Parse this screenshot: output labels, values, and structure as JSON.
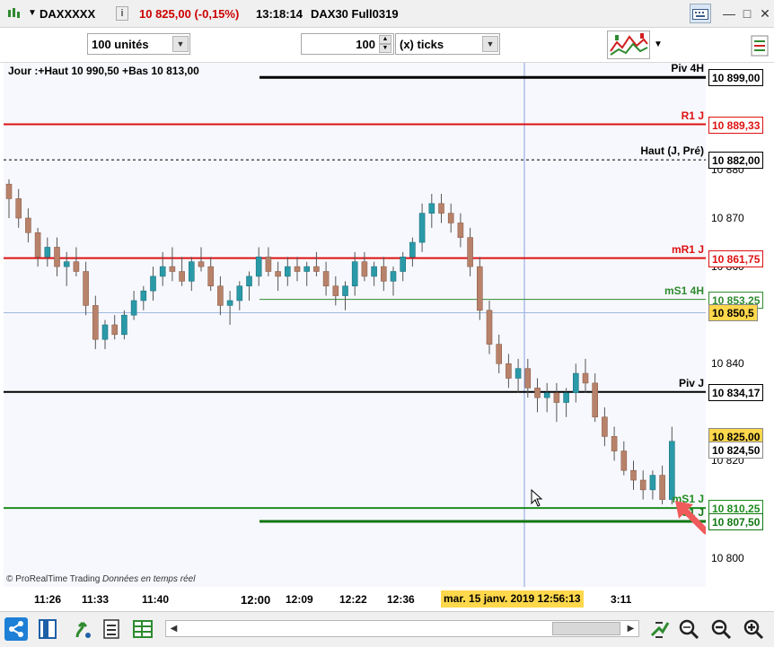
{
  "titlebar": {
    "instrument": "DAXXXXX",
    "price": "10 825,00 (-0,15%)",
    "time": "13:18:14",
    "name": "DAX30 Full0319",
    "colors": {
      "price": "#cc0000"
    }
  },
  "toolbar": {
    "units": "100 unités",
    "ticks_value": "100",
    "ticks_label": "(x) ticks"
  },
  "chart": {
    "day_info": "Jour :+Haut 10 990,50 +Bas 10 813,00",
    "source": "© ProRealTime Trading",
    "source_note": "Données en temps réel"
  },
  "levels": [
    {
      "name": "Piv 4H",
      "value": "10 899,00",
      "price": 10899.0,
      "color": "#000000",
      "style": "solid-thick",
      "label_color": "#000000",
      "box_color": "#000000"
    },
    {
      "name": "R1 J",
      "value": "10 889,33",
      "price": 10889.33,
      "color": "#dd1111",
      "style": "solid",
      "label_color": "#dd1111",
      "box_color": "#dd1111"
    },
    {
      "name": "Haut (J, Pré)",
      "value": "10 882,00",
      "price": 10882.0,
      "color": "#000000",
      "style": "dashed",
      "label_color": "#000000",
      "box_color": "#000000"
    },
    {
      "name": "mR1 J",
      "value": "10 861,75",
      "price": 10861.75,
      "color": "#dd1111",
      "style": "solid",
      "label_color": "#dd1111",
      "box_color": "#dd1111"
    },
    {
      "name": "mS1 4H",
      "value": "10 853,25",
      "price": 10853.25,
      "color": "#2f8a2f",
      "style": "thin",
      "label_color": "#2f8a2f",
      "box_color": "#2f8a2f"
    },
    {
      "name": "Piv J",
      "value": "10 834,17",
      "price": 10834.17,
      "color": "#000000",
      "style": "solid",
      "label_color": "#000000",
      "box_color": "#000000"
    },
    {
      "name": "mS1 J",
      "value": "10 810,25",
      "price": 10810.25,
      "color": "#1e8c1e",
      "style": "solid",
      "label_color": "#1e8c1e",
      "box_color": "#1e8c1e"
    },
    {
      "name": "S1 J",
      "value": "10 807,50",
      "price": 10807.5,
      "color": "#117711",
      "style": "solid-thick",
      "label_color": "#117711",
      "box_color": "#117711"
    }
  ],
  "crosshair": {
    "value": "10 850,5",
    "price": 10850.5
  },
  "last_price": {
    "value": "10 825,00",
    "price": 10825.0
  },
  "current_price": {
    "value": "10 824,50",
    "price": 10824.5
  },
  "scale_ticks": [
    "10 880",
    "10 870",
    "10 860",
    "10 840",
    "10 820",
    "10 800"
  ],
  "time_labels": [
    "11:26",
    "11:33",
    "11:40",
    "12:00",
    "12:09",
    "12:22",
    "12:36",
    "3:11"
  ],
  "cursor_time": "mar. 15 janv. 2019 12:56:13",
  "chart_data": {
    "type": "candlestick",
    "y_range": [
      10794,
      10902
    ],
    "colors": {
      "up": "#2a9aa8",
      "down": "#b8826a",
      "wick": "#555555"
    },
    "candles": [
      [
        10877,
        10878,
        10870,
        10874
      ],
      [
        10874,
        10876,
        10868,
        10870
      ],
      [
        10870,
        10872,
        10865,
        10867
      ],
      [
        10867,
        10868,
        10860,
        10862
      ],
      [
        10862,
        10866,
        10860,
        10864
      ],
      [
        10864,
        10866,
        10858,
        10860
      ],
      [
        10860,
        10863,
        10856,
        10861
      ],
      [
        10861,
        10864,
        10858,
        10859
      ],
      [
        10859,
        10861,
        10850,
        10852
      ],
      [
        10852,
        10854,
        10843,
        10845
      ],
      [
        10845,
        10849,
        10843,
        10848
      ],
      [
        10848,
        10850,
        10845,
        10846
      ],
      [
        10846,
        10851,
        10845,
        10850
      ],
      [
        10850,
        10855,
        10849,
        10853
      ],
      [
        10853,
        10856,
        10851,
        10855
      ],
      [
        10855,
        10860,
        10853,
        10858
      ],
      [
        10858,
        10863,
        10856,
        10860
      ],
      [
        10860,
        10864,
        10857,
        10859
      ],
      [
        10859,
        10862,
        10856,
        10857
      ],
      [
        10857,
        10862,
        10855,
        10861
      ],
      [
        10861,
        10864,
        10859,
        10860
      ],
      [
        10860,
        10862,
        10855,
        10856
      ],
      [
        10856,
        10858,
        10850,
        10852
      ],
      [
        10852,
        10855,
        10848,
        10853
      ],
      [
        10853,
        10857,
        10851,
        10856
      ],
      [
        10856,
        10859,
        10853,
        10858
      ],
      [
        10858,
        10864,
        10856,
        10862
      ],
      [
        10862,
        10864,
        10858,
        10859
      ],
      [
        10859,
        10861,
        10855,
        10858
      ],
      [
        10858,
        10862,
        10856,
        10860
      ],
      [
        10860,
        10862,
        10857,
        10859
      ],
      [
        10859,
        10861,
        10856,
        10860
      ],
      [
        10860,
        10863,
        10858,
        10859
      ],
      [
        10859,
        10861,
        10854,
        10856
      ],
      [
        10856,
        10858,
        10852,
        10854
      ],
      [
        10854,
        10857,
        10851,
        10856
      ],
      [
        10856,
        10863,
        10854,
        10861
      ],
      [
        10861,
        10863,
        10857,
        10858
      ],
      [
        10858,
        10861,
        10856,
        10860
      ],
      [
        10860,
        10862,
        10855,
        10857
      ],
      [
        10857,
        10860,
        10854,
        10859
      ],
      [
        10859,
        10863,
        10857,
        10862
      ],
      [
        10862,
        10866,
        10860,
        10865
      ],
      [
        10865,
        10873,
        10863,
        10871
      ],
      [
        10871,
        10875,
        10868,
        10873
      ],
      [
        10873,
        10875,
        10869,
        10871
      ],
      [
        10871,
        10873,
        10867,
        10869
      ],
      [
        10869,
        10871,
        10864,
        10866
      ],
      [
        10866,
        10868,
        10858,
        10860
      ],
      [
        10860,
        10862,
        10849,
        10851
      ],
      [
        10851,
        10853,
        10842,
        10844
      ],
      [
        10844,
        10846,
        10838,
        10840
      ],
      [
        10840,
        10842,
        10835,
        10837
      ],
      [
        10837,
        10841,
        10834,
        10839
      ],
      [
        10839,
        10841,
        10833,
        10835
      ],
      [
        10835,
        10837,
        10830,
        10833
      ],
      [
        10833,
        10836,
        10830,
        10834
      ],
      [
        10834,
        10836,
        10828,
        10832
      ],
      [
        10832,
        10835,
        10829,
        10834
      ],
      [
        10834,
        10840,
        10832,
        10838
      ],
      [
        10838,
        10841,
        10834,
        10836
      ],
      [
        10836,
        10838,
        10828,
        10829
      ],
      [
        10829,
        10831,
        10823,
        10825
      ],
      [
        10825,
        10827,
        10820,
        10822
      ],
      [
        10822,
        10824,
        10817,
        10818
      ],
      [
        10818,
        10820,
        10814,
        10816
      ],
      [
        10816,
        10818,
        10812,
        10814
      ],
      [
        10814,
        10818,
        10812,
        10817
      ],
      [
        10817,
        10819,
        10811,
        10812
      ],
      [
        10812,
        10827,
        10811,
        10824
      ]
    ]
  }
}
